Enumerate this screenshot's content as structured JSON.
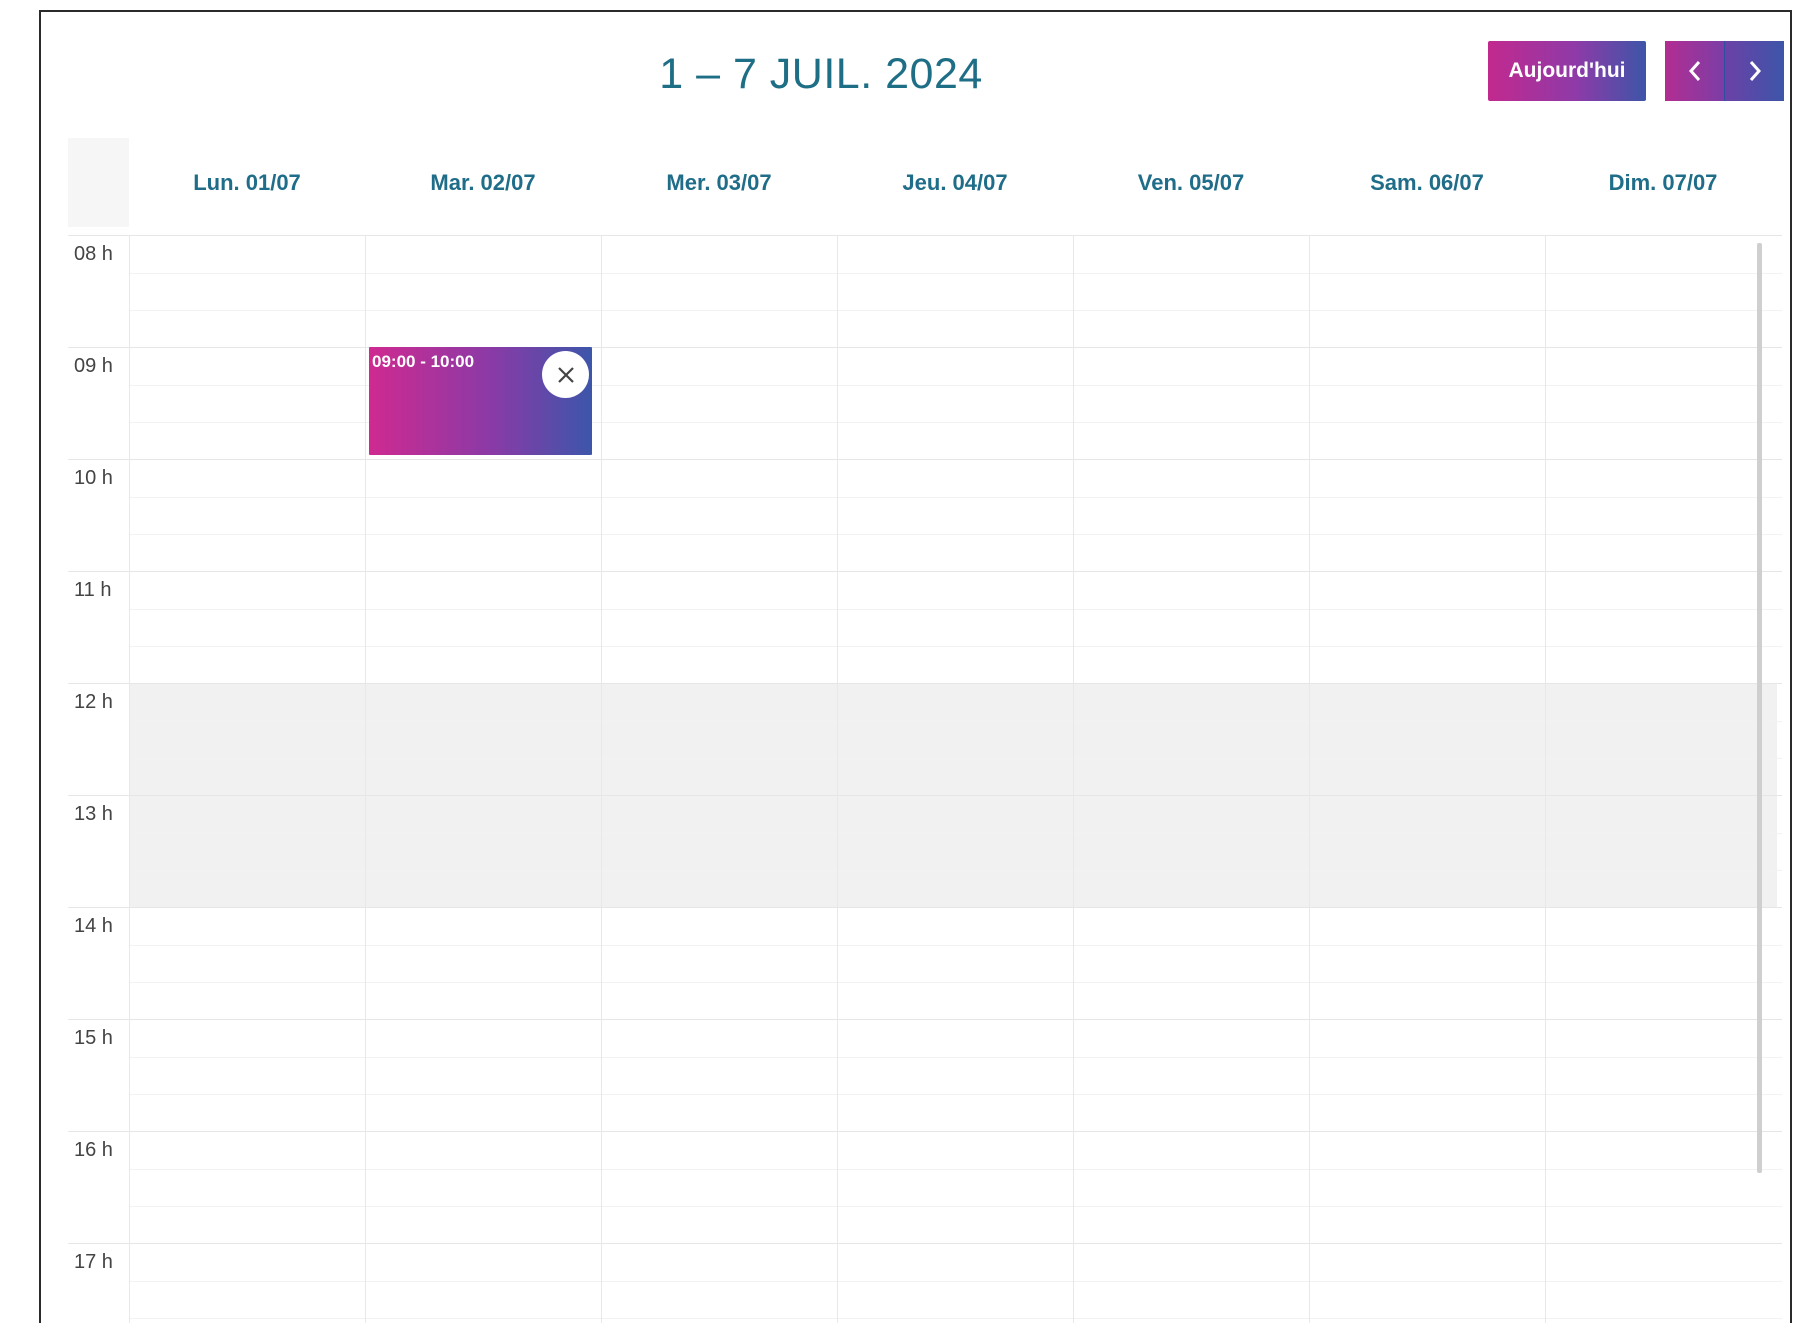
{
  "header": {
    "title": "1 – 7 JUIL. 2024",
    "today_label": "Aujourd'hui",
    "prev_icon": "chevron-left-icon",
    "next_icon": "chevron-right-icon"
  },
  "days": [
    {
      "label": "Lun. 01/07"
    },
    {
      "label": "Mar. 02/07"
    },
    {
      "label": "Mer. 03/07"
    },
    {
      "label": "Jeu. 04/07"
    },
    {
      "label": "Ven. 05/07"
    },
    {
      "label": "Sam. 06/07"
    },
    {
      "label": "Dim. 07/07"
    }
  ],
  "hours": [
    "08 h",
    "09 h",
    "10 h",
    "11 h",
    "12 h",
    "13 h",
    "14 h",
    "15 h",
    "16 h",
    "17 h"
  ],
  "lunch_break": {
    "start": "12 h",
    "end": "14 h"
  },
  "events": [
    {
      "day": "Mar. 02/07",
      "time": "09:00 - 10:00",
      "close_icon": "close-icon"
    }
  ],
  "colors": {
    "accent_start": "#c2298e",
    "accent_end": "#3d55a8",
    "title": "#1e6e86",
    "day_header": "#1f6d88",
    "lunch_bg": "#f1f1f1"
  }
}
